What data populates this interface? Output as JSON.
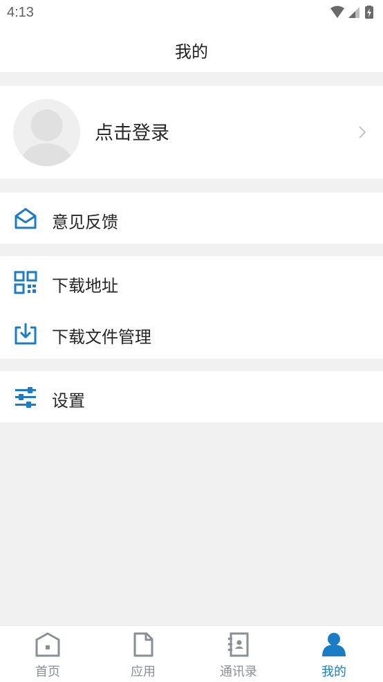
{
  "status_bar": {
    "time": "4:13",
    "icons": [
      "wifi-icon",
      "signal-icon",
      "battery-charging-icon"
    ]
  },
  "app_bar": {
    "title": "我的"
  },
  "profile": {
    "login_label": "点击登录",
    "icon": "chevron-right-icon"
  },
  "menu": {
    "feedback": {
      "label": "意见反馈",
      "icon": "mail-open-icon"
    },
    "download_address": {
      "label": "下载地址",
      "icon": "qr-code-icon"
    },
    "download_files": {
      "label": "下载文件管理",
      "icon": "download-tray-icon"
    },
    "settings": {
      "label": "设置",
      "icon": "sliders-icon"
    }
  },
  "tabs": [
    {
      "label": "首页",
      "icon": "home-icon",
      "active": false
    },
    {
      "label": "应用",
      "icon": "document-icon",
      "active": false
    },
    {
      "label": "通讯录",
      "icon": "contacts-book-icon",
      "active": false
    },
    {
      "label": "我的",
      "icon": "user-icon",
      "active": true
    }
  ],
  "colors": {
    "accent": "#1a7cc6",
    "inactive_tab": "#8a8f96",
    "background": "#f1f1f1",
    "surface": "#ffffff"
  }
}
